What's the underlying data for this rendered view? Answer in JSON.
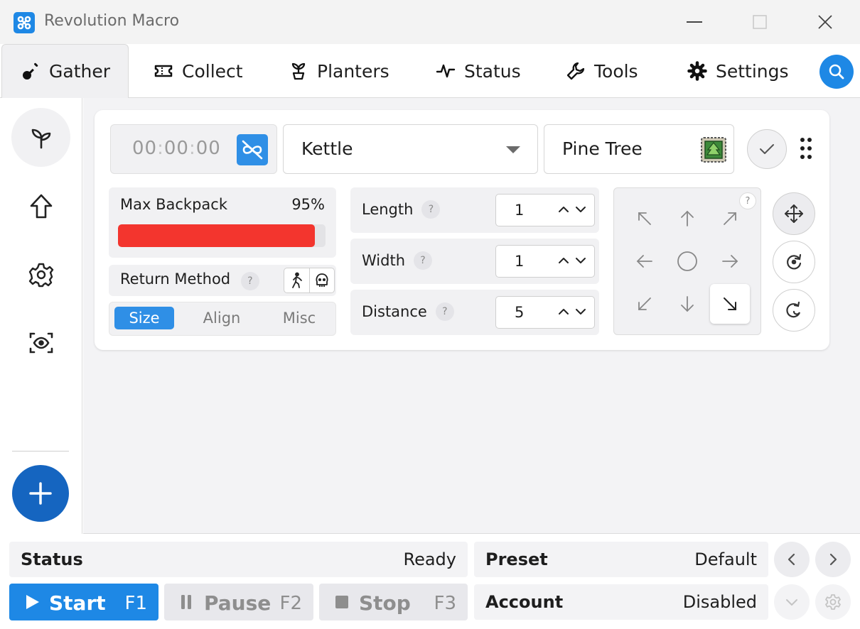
{
  "window": {
    "title": "Revolution Macro"
  },
  "tabs": [
    {
      "label": "Gather",
      "icon": "shovel-icon"
    },
    {
      "label": "Collect",
      "icon": "ticket-icon"
    },
    {
      "label": "Planters",
      "icon": "sprout-pot-icon"
    },
    {
      "label": "Status",
      "icon": "pulse-icon"
    },
    {
      "label": "Tools",
      "icon": "wrench-icon"
    },
    {
      "label": "Settings",
      "icon": "gear-icon"
    }
  ],
  "gather": {
    "timer": {
      "h": "00",
      "sep": ":",
      "m": "00",
      "s": "00"
    },
    "pattern": "Kettle",
    "field": "Pine Tree",
    "max_backpack_label": "Max Backpack",
    "max_backpack_value": "95%",
    "max_backpack_fraction": 0.95,
    "return_method_label": "Return Method",
    "help_glyph": "?",
    "segments": [
      "Size",
      "Align",
      "Misc"
    ],
    "length_label": "Length",
    "length_value": "1",
    "width_label": "Width",
    "width_value": "1",
    "distance_label": "Distance",
    "distance_value": "5"
  },
  "status": {
    "label": "Status",
    "value": "Ready"
  },
  "preset": {
    "label": "Preset",
    "value": "Default"
  },
  "account": {
    "label": "Account",
    "value": "Disabled"
  },
  "actions": {
    "start_label": "Start",
    "start_key": "F1",
    "pause_label": "Pause",
    "pause_key": "F2",
    "stop_label": "Stop",
    "stop_key": "F3"
  },
  "colors": {
    "accent": "#1e88e5",
    "backpack_fill": "#f3352e"
  }
}
